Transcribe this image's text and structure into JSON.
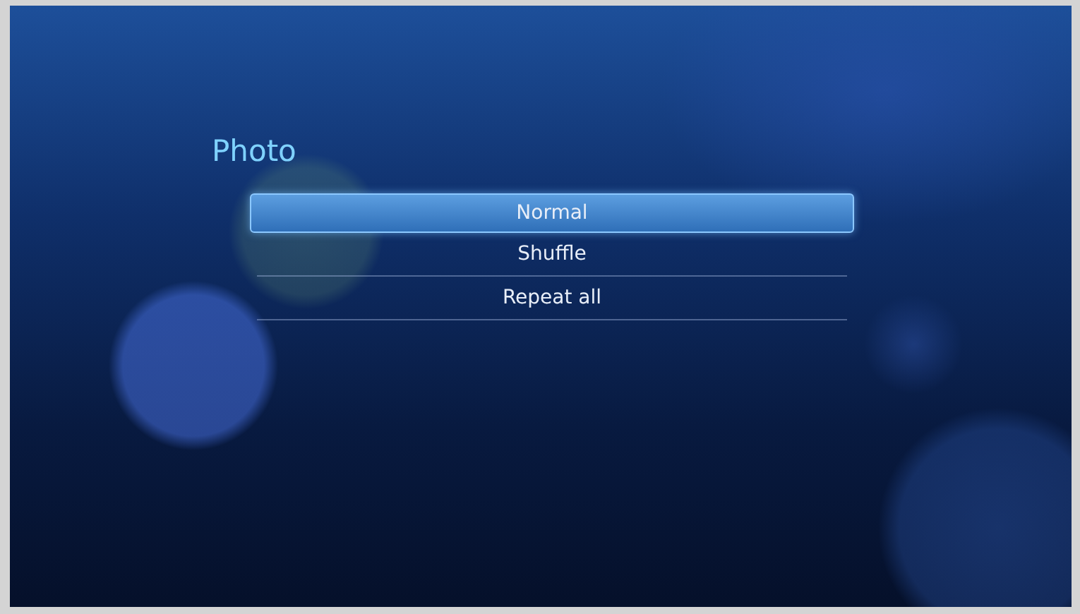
{
  "title": "Photo",
  "menu": [
    {
      "label": "Normal",
      "selected": true
    },
    {
      "label": "Shuffle",
      "selected": false
    },
    {
      "label": "Repeat all",
      "selected": false
    }
  ]
}
